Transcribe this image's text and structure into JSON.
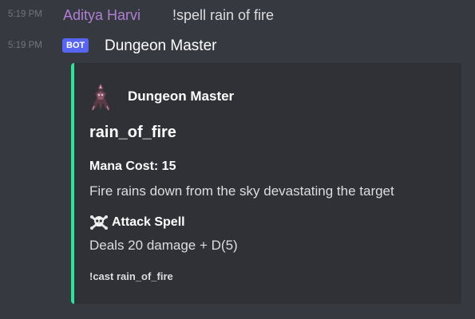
{
  "messages": [
    {
      "timestamp": "5:19 PM",
      "author": "Aditya Harvi",
      "content": "!spell rain of fire"
    },
    {
      "timestamp": "5:19 PM",
      "badge": "BOT",
      "author": "Dungeon Master"
    }
  ],
  "embed": {
    "accent_color": "#2ee49b",
    "author_icon": "dungeon-master-avatar-icon",
    "author_name": "Dungeon Master",
    "title": "rain_of_fire",
    "fields": [
      {
        "name": "Mana Cost: 15",
        "value": "Fire rains down from the sky devastating the target"
      },
      {
        "icon": "skull-crossbones-icon",
        "name": "Attack Spell",
        "value": "Deals 20 damage + D(5)"
      }
    ],
    "footer": "!cast rain_of_fire"
  },
  "colors": {
    "background": "#36393f",
    "embed_background": "#2f3136",
    "user_name": "#b07ed6",
    "bot_badge": "#5865f2"
  }
}
